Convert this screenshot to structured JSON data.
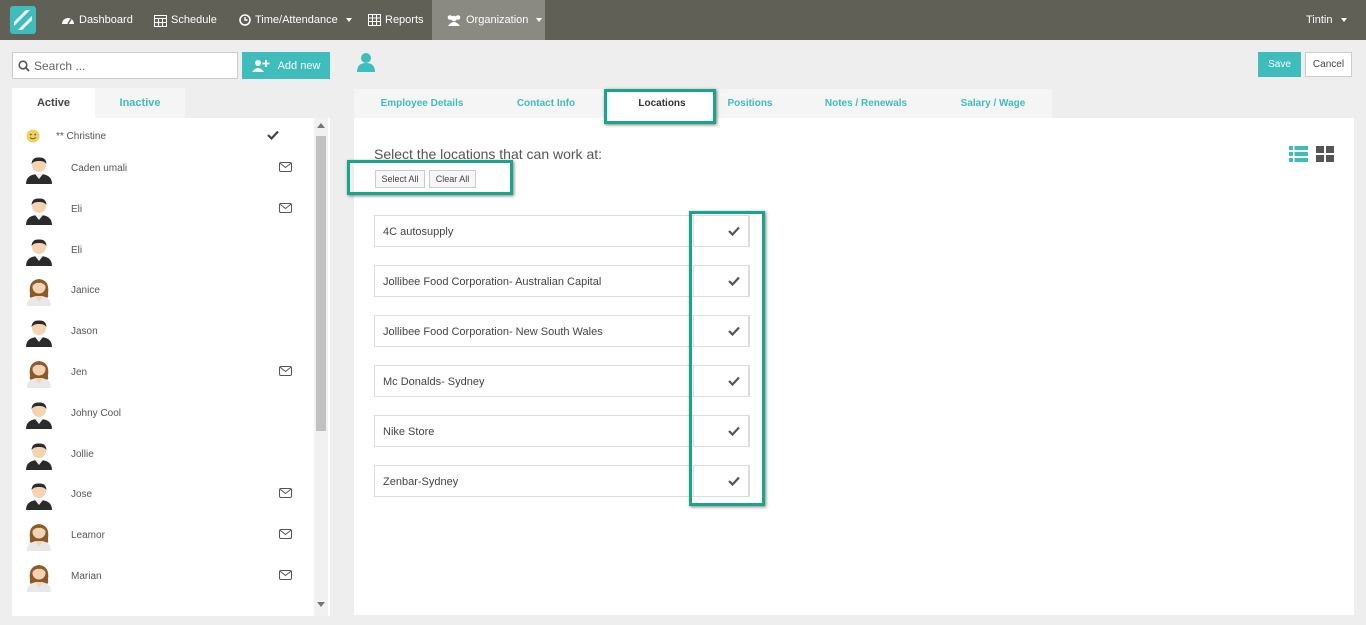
{
  "nav": {
    "items": [
      {
        "label": "Dashboard",
        "icon": "dashboard-icon"
      },
      {
        "label": "Schedule",
        "icon": "calendar-icon"
      },
      {
        "label": "Time/Attendance",
        "icon": "clock-icon"
      },
      {
        "label": "Reports",
        "icon": "table-icon"
      },
      {
        "label": "Organization",
        "icon": "users-icon"
      }
    ],
    "user": "Tintin"
  },
  "left": {
    "search_placeholder": "Search ...",
    "add_label": "Add new",
    "tab_active": "Active",
    "tab_inactive": "Inactive",
    "employees": [
      {
        "name": "** Christine",
        "right": "check",
        "gender": "smiley"
      },
      {
        "name": "Caden umali",
        "right": "mail",
        "gender": "m"
      },
      {
        "name": "Eli",
        "right": "mail",
        "gender": "m"
      },
      {
        "name": "Eli",
        "right": "",
        "gender": "m"
      },
      {
        "name": "Janice",
        "right": "",
        "gender": "f"
      },
      {
        "name": "Jason",
        "right": "",
        "gender": "m"
      },
      {
        "name": "Jen",
        "right": "mail",
        "gender": "f"
      },
      {
        "name": "Johny Cool",
        "right": "",
        "gender": "m"
      },
      {
        "name": "Jollie",
        "right": "",
        "gender": "m"
      },
      {
        "name": "Jose",
        "right": "mail",
        "gender": "m"
      },
      {
        "name": "Leamor",
        "right": "mail",
        "gender": "f"
      },
      {
        "name": "Marian",
        "right": "mail",
        "gender": "f"
      }
    ]
  },
  "toolbar": {
    "save_label": "Save",
    "cancel_label": "Cancel"
  },
  "tabs": [
    {
      "label": "Employee Details"
    },
    {
      "label": "Contact Info"
    },
    {
      "label": "Locations"
    },
    {
      "label": "Positions"
    },
    {
      "label": "Notes / Renewals"
    },
    {
      "label": "Salary / Wage"
    }
  ],
  "content": {
    "title": "Select the locations that can work at:",
    "select_all": "Select All",
    "clear_all": "Clear All",
    "locations": [
      {
        "name": "4C autosupply",
        "checked": true
      },
      {
        "name": "Jollibee Food Corporation- Australian Capital",
        "checked": true
      },
      {
        "name": "Jollibee Food Corporation- New South Wales",
        "checked": true
      },
      {
        "name": "Mc Donalds- Sydney",
        "checked": true
      },
      {
        "name": "Nike Store",
        "checked": true
      },
      {
        "name": "Zenbar-Sydney",
        "checked": true
      }
    ]
  },
  "colors": {
    "accent": "#3fbcbc",
    "nav_bg": "#606057",
    "highlight": "#1aa58a"
  }
}
